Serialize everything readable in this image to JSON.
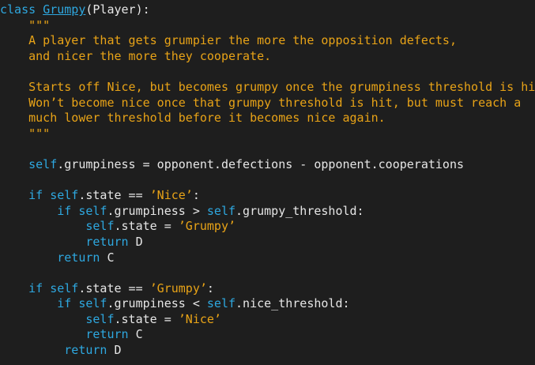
{
  "editor": {
    "theme": {
      "background": "#1e1e1e",
      "keyword": "#2ea8e0",
      "string": "#e8a317",
      "text": "#e6e6e6"
    },
    "lines": [
      {
        "indent": "",
        "tokens": [
          {
            "t": "kw",
            "v": "class"
          },
          {
            "t": "name",
            "v": " "
          },
          {
            "t": "cls",
            "v": "Grumpy"
          },
          {
            "t": "name",
            "v": "(Player):"
          }
        ]
      },
      {
        "indent": "    ",
        "tokens": [
          {
            "t": "str",
            "v": "\"\"\""
          }
        ]
      },
      {
        "indent": "    ",
        "tokens": [
          {
            "t": "str",
            "v": "A player that gets grumpier the more the opposition defects,"
          }
        ]
      },
      {
        "indent": "    ",
        "tokens": [
          {
            "t": "str",
            "v": "and nicer the more they cooperate."
          }
        ]
      },
      {
        "indent": "",
        "tokens": []
      },
      {
        "indent": "    ",
        "tokens": [
          {
            "t": "str",
            "v": "Starts off Nice, but becomes grumpy once the grumpiness threshold is hit."
          }
        ]
      },
      {
        "indent": "    ",
        "tokens": [
          {
            "t": "str",
            "v": "Won’t become nice once that grumpy threshold is hit, but must reach a"
          }
        ]
      },
      {
        "indent": "    ",
        "tokens": [
          {
            "t": "str",
            "v": "much lower threshold before it becomes nice again."
          }
        ]
      },
      {
        "indent": "    ",
        "tokens": [
          {
            "t": "str",
            "v": "\"\"\""
          }
        ]
      },
      {
        "indent": "",
        "tokens": []
      },
      {
        "indent": "    ",
        "tokens": [
          {
            "t": "slf",
            "v": "self"
          },
          {
            "t": "name",
            "v": ".grumpiness = opponent.defections - opponent.cooperations"
          }
        ]
      },
      {
        "indent": "",
        "tokens": []
      },
      {
        "indent": "    ",
        "tokens": [
          {
            "t": "kw",
            "v": "if"
          },
          {
            "t": "name",
            "v": " "
          },
          {
            "t": "slf",
            "v": "self"
          },
          {
            "t": "name",
            "v": ".state == "
          },
          {
            "t": "str",
            "v": "’Nice’"
          },
          {
            "t": "name",
            "v": ":"
          }
        ]
      },
      {
        "indent": "        ",
        "tokens": [
          {
            "t": "kw",
            "v": "if"
          },
          {
            "t": "name",
            "v": " "
          },
          {
            "t": "slf",
            "v": "self"
          },
          {
            "t": "name",
            "v": ".grumpiness > "
          },
          {
            "t": "slf",
            "v": "self"
          },
          {
            "t": "name",
            "v": ".grumpy_threshold:"
          }
        ]
      },
      {
        "indent": "            ",
        "tokens": [
          {
            "t": "slf",
            "v": "self"
          },
          {
            "t": "name",
            "v": ".state = "
          },
          {
            "t": "str",
            "v": "’Grumpy’"
          }
        ]
      },
      {
        "indent": "            ",
        "tokens": [
          {
            "t": "kw",
            "v": "return"
          },
          {
            "t": "name",
            "v": " D"
          }
        ]
      },
      {
        "indent": "        ",
        "tokens": [
          {
            "t": "kw",
            "v": "return"
          },
          {
            "t": "name",
            "v": " C"
          }
        ]
      },
      {
        "indent": "",
        "tokens": []
      },
      {
        "indent": "    ",
        "tokens": [
          {
            "t": "kw",
            "v": "if"
          },
          {
            "t": "name",
            "v": " "
          },
          {
            "t": "slf",
            "v": "self"
          },
          {
            "t": "name",
            "v": ".state == "
          },
          {
            "t": "str",
            "v": "’Grumpy’"
          },
          {
            "t": "name",
            "v": ":"
          }
        ]
      },
      {
        "indent": "        ",
        "tokens": [
          {
            "t": "kw",
            "v": "if"
          },
          {
            "t": "name",
            "v": " "
          },
          {
            "t": "slf",
            "v": "self"
          },
          {
            "t": "name",
            "v": ".grumpiness < "
          },
          {
            "t": "slf",
            "v": "self"
          },
          {
            "t": "name",
            "v": ".nice_threshold:"
          }
        ]
      },
      {
        "indent": "            ",
        "tokens": [
          {
            "t": "slf",
            "v": "self"
          },
          {
            "t": "name",
            "v": ".state = "
          },
          {
            "t": "str",
            "v": "’Nice’"
          }
        ]
      },
      {
        "indent": "            ",
        "tokens": [
          {
            "t": "kw",
            "v": "return"
          },
          {
            "t": "name",
            "v": " C"
          }
        ]
      },
      {
        "indent": "         ",
        "tokens": [
          {
            "t": "kw",
            "v": "return"
          },
          {
            "t": "name",
            "v": " D"
          }
        ]
      }
    ]
  }
}
